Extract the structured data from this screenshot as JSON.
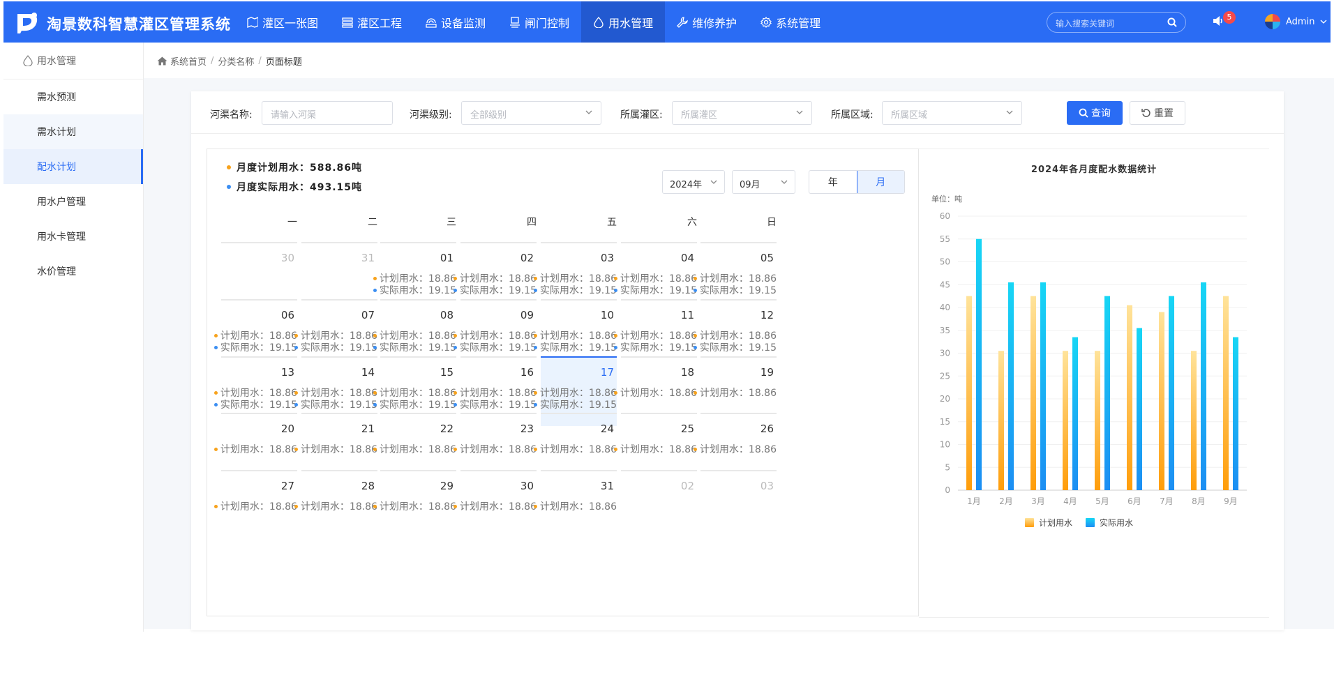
{
  "app": {
    "title": "淘景数科智慧灌区管理系统"
  },
  "nav": [
    {
      "label": "灌区一张图",
      "icon": "map-icon",
      "active": false
    },
    {
      "label": "灌区工程",
      "icon": "project-icon",
      "active": false
    },
    {
      "label": "设备监测",
      "icon": "monitor-icon",
      "active": false
    },
    {
      "label": "闸门控制",
      "icon": "gate-icon",
      "active": false
    },
    {
      "label": "用水管理",
      "icon": "water-drop-icon",
      "active": true
    },
    {
      "label": "维修养护",
      "icon": "wrench-icon",
      "active": false
    },
    {
      "label": "系统管理",
      "icon": "gear-icon",
      "active": false
    }
  ],
  "header": {
    "search_placeholder": "输入搜索关键词",
    "notification_count": "5",
    "user": "Admin"
  },
  "sidebar": {
    "title": "用水管理",
    "items": [
      {
        "label": "需水预测",
        "state": "normal"
      },
      {
        "label": "需水计划",
        "state": "tint"
      },
      {
        "label": "配水计划",
        "state": "active"
      },
      {
        "label": "用水户管理",
        "state": "normal"
      },
      {
        "label": "用水卡管理",
        "state": "normal"
      },
      {
        "label": "水价管理",
        "state": "normal"
      }
    ]
  },
  "breadcrumb": [
    "系统首页",
    "分类名称",
    "页面标题"
  ],
  "filters": {
    "canal_name": {
      "label": "河渠名称:",
      "placeholder": "请输入河渠"
    },
    "canal_level": {
      "label": "河渠级别:",
      "placeholder": "全部级别"
    },
    "district": {
      "label": "所属灌区:",
      "placeholder": "所属灌区"
    },
    "region": {
      "label": "所属区域:",
      "placeholder": "所属区域"
    },
    "query_label": "查询",
    "reset_label": "重置"
  },
  "calendar": {
    "planned_total": "月度计划用水：588.86吨",
    "actual_total": "月度实际用水：493.15吨",
    "year": "2024年",
    "month": "09月",
    "view_year": "年",
    "view_month": "月",
    "weekdays": [
      "一",
      "二",
      "三",
      "四",
      "五",
      "六",
      "日"
    ],
    "plan_line": "计划用水：18.86",
    "actual_line": "实际用水：19.15",
    "today": "17",
    "days": [
      {
        "d": "30",
        "other": true,
        "plan": false,
        "actual": false
      },
      {
        "d": "31",
        "other": true,
        "plan": false,
        "actual": false
      },
      {
        "d": "01",
        "other": false,
        "plan": true,
        "actual": true
      },
      {
        "d": "02",
        "other": false,
        "plan": true,
        "actual": true
      },
      {
        "d": "03",
        "other": false,
        "plan": true,
        "actual": true
      },
      {
        "d": "04",
        "other": false,
        "plan": true,
        "actual": true
      },
      {
        "d": "05",
        "other": false,
        "plan": true,
        "actual": true
      },
      {
        "d": "06",
        "other": false,
        "plan": true,
        "actual": true
      },
      {
        "d": "07",
        "other": false,
        "plan": true,
        "actual": true
      },
      {
        "d": "08",
        "other": false,
        "plan": true,
        "actual": true
      },
      {
        "d": "09",
        "other": false,
        "plan": true,
        "actual": true
      },
      {
        "d": "10",
        "other": false,
        "plan": true,
        "actual": true
      },
      {
        "d": "11",
        "other": false,
        "plan": true,
        "actual": true
      },
      {
        "d": "12",
        "other": false,
        "plan": true,
        "actual": true
      },
      {
        "d": "13",
        "other": false,
        "plan": true,
        "actual": true
      },
      {
        "d": "14",
        "other": false,
        "plan": true,
        "actual": true
      },
      {
        "d": "15",
        "other": false,
        "plan": true,
        "actual": true
      },
      {
        "d": "16",
        "other": false,
        "plan": true,
        "actual": true
      },
      {
        "d": "17",
        "other": false,
        "plan": true,
        "actual": true
      },
      {
        "d": "18",
        "other": false,
        "plan": true,
        "actual": false
      },
      {
        "d": "19",
        "other": false,
        "plan": true,
        "actual": false
      },
      {
        "d": "20",
        "other": false,
        "plan": true,
        "actual": false
      },
      {
        "d": "21",
        "other": false,
        "plan": true,
        "actual": false
      },
      {
        "d": "22",
        "other": false,
        "plan": true,
        "actual": false
      },
      {
        "d": "23",
        "other": false,
        "plan": true,
        "actual": false
      },
      {
        "d": "24",
        "other": false,
        "plan": true,
        "actual": false
      },
      {
        "d": "25",
        "other": false,
        "plan": true,
        "actual": false
      },
      {
        "d": "26",
        "other": false,
        "plan": true,
        "actual": false
      },
      {
        "d": "27",
        "other": false,
        "plan": true,
        "actual": false
      },
      {
        "d": "28",
        "other": false,
        "plan": true,
        "actual": false
      },
      {
        "d": "29",
        "other": false,
        "plan": true,
        "actual": false
      },
      {
        "d": "30",
        "other": false,
        "plan": true,
        "actual": false
      },
      {
        "d": "31",
        "other": false,
        "plan": true,
        "actual": false
      },
      {
        "d": "02",
        "other": true,
        "plan": false,
        "actual": false
      },
      {
        "d": "03",
        "other": true,
        "plan": false,
        "actual": false
      }
    ]
  },
  "chart_data": {
    "type": "bar",
    "title": "2024年各月度配水数据统计",
    "ylabel": "单位：吨",
    "xlabel": "",
    "categories": [
      "1月",
      "2月",
      "3月",
      "4月",
      "5月",
      "6月",
      "7月",
      "8月",
      "9月"
    ],
    "series": [
      {
        "name": "计划用水",
        "values": [
          42.5,
          30.5,
          42.5,
          30.5,
          30.5,
          40.5,
          39,
          30.5,
          42.5
        ],
        "color": "#ffd35c"
      },
      {
        "name": "实际用水",
        "values": [
          55,
          45.5,
          45.5,
          33.5,
          42.5,
          35.5,
          42.5,
          45.5,
          33.5
        ],
        "color": "#19c8f5"
      }
    ],
    "ylim": [
      0,
      60
    ],
    "yticks": [
      0,
      5,
      10,
      15,
      20,
      25,
      30,
      35,
      40,
      45,
      50,
      55,
      60
    ],
    "grid": true,
    "legend": "bottom"
  }
}
